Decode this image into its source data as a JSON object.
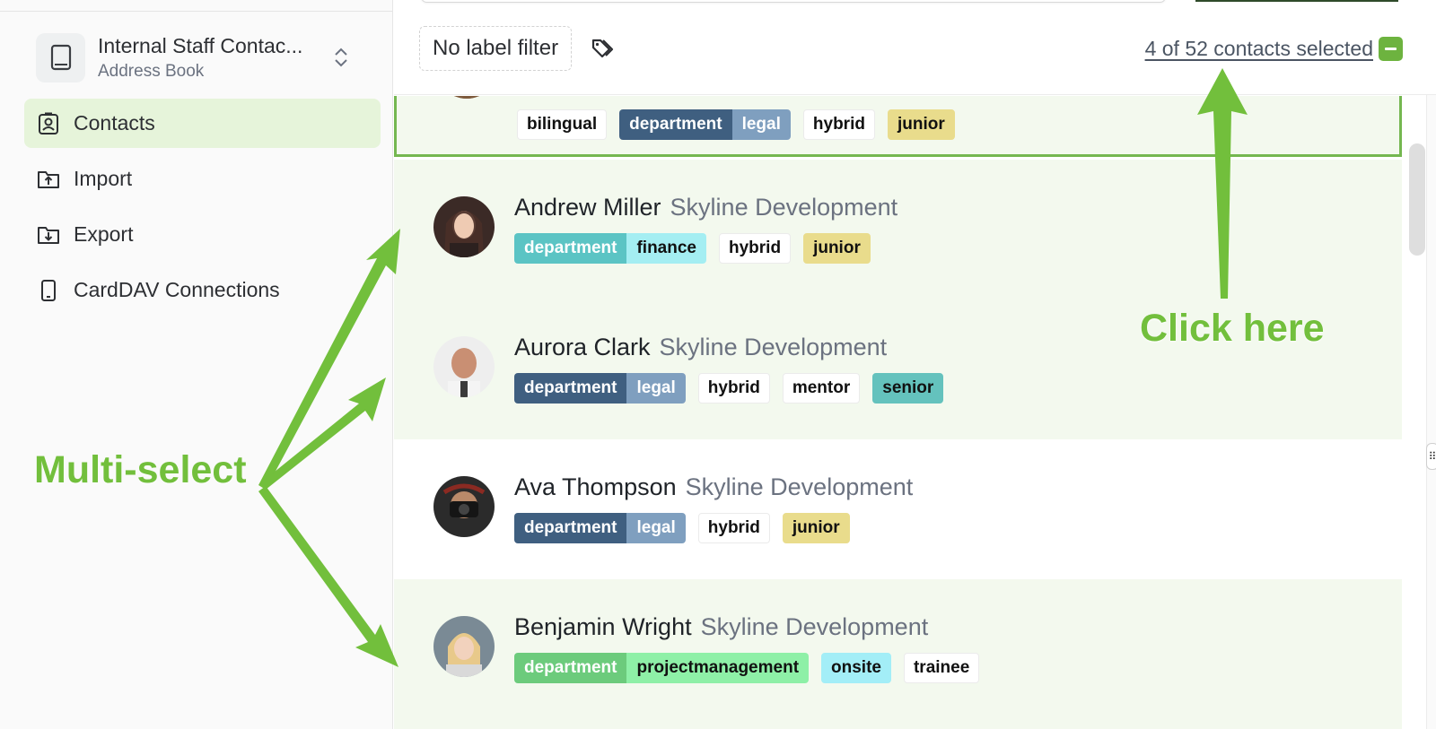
{
  "sidebar": {
    "address_book": {
      "name": "Internal Staff Contac...",
      "subtitle": "Address Book",
      "icon": "book-icon",
      "switch_icon": "chevron-up-down-icon"
    },
    "nav": [
      {
        "label": "Contacts",
        "icon": "contact-card-icon",
        "active": true
      },
      {
        "label": "Import",
        "icon": "folder-upload-icon",
        "active": false
      },
      {
        "label": "Export",
        "icon": "folder-download-icon",
        "active": false
      },
      {
        "label": "CardDAV Connections",
        "icon": "phone-icon",
        "active": false
      }
    ]
  },
  "toolbar": {
    "label_filter": "No label filter",
    "tags_icon": "tags-icon",
    "selection_text": "4 of 52 contacts selected"
  },
  "contacts": [
    {
      "name": "",
      "company": "",
      "selected": true,
      "tags": [
        "bilingual",
        "department:legal",
        "hybrid",
        "junior"
      ]
    },
    {
      "name": "Andrew Miller",
      "company": "Skyline Development",
      "selected": true,
      "tags": [
        "department:finance",
        "hybrid",
        "junior"
      ]
    },
    {
      "name": "Aurora Clark",
      "company": "Skyline Development",
      "selected": true,
      "tags": [
        "department:legal",
        "hybrid",
        "mentor",
        "senior"
      ]
    },
    {
      "name": "Ava Thompson",
      "company": "Skyline Development",
      "selected": false,
      "tags": [
        "department:legal",
        "hybrid",
        "junior"
      ]
    },
    {
      "name": "Benjamin Wright",
      "company": "Skyline Development",
      "selected": true,
      "tags": [
        "department:projectmanagement",
        "onsite",
        "trainee"
      ]
    }
  ],
  "tag_labels": {
    "bilingual": "bilingual",
    "department": "department",
    "legal": "legal",
    "finance": "finance",
    "projectmanagement": "projectmanagement",
    "hybrid": "hybrid",
    "junior": "junior",
    "mentor": "mentor",
    "senior": "senior",
    "onsite": "onsite",
    "trainee": "trainee"
  },
  "colors": {
    "accent_green": "#6db33f",
    "annotation_green": "#72bf3c",
    "selected_row": "#f3f9ee",
    "active_nav": "#e6f4da",
    "dept_legal_key": "#3f5f80",
    "dept_legal_val": "#7f9fbf",
    "dept_finance_key": "#5bc4c4",
    "dept_finance_val": "#a4eef2",
    "dept_pm_key": "#6ccb7c",
    "dept_pm_val": "#8ef0a7",
    "junior": "#e9dc8c",
    "senior": "#64c2bd",
    "onsite": "#a3eef7"
  },
  "annotations": {
    "click_here": "Click here",
    "multi_select": "Multi-select"
  }
}
